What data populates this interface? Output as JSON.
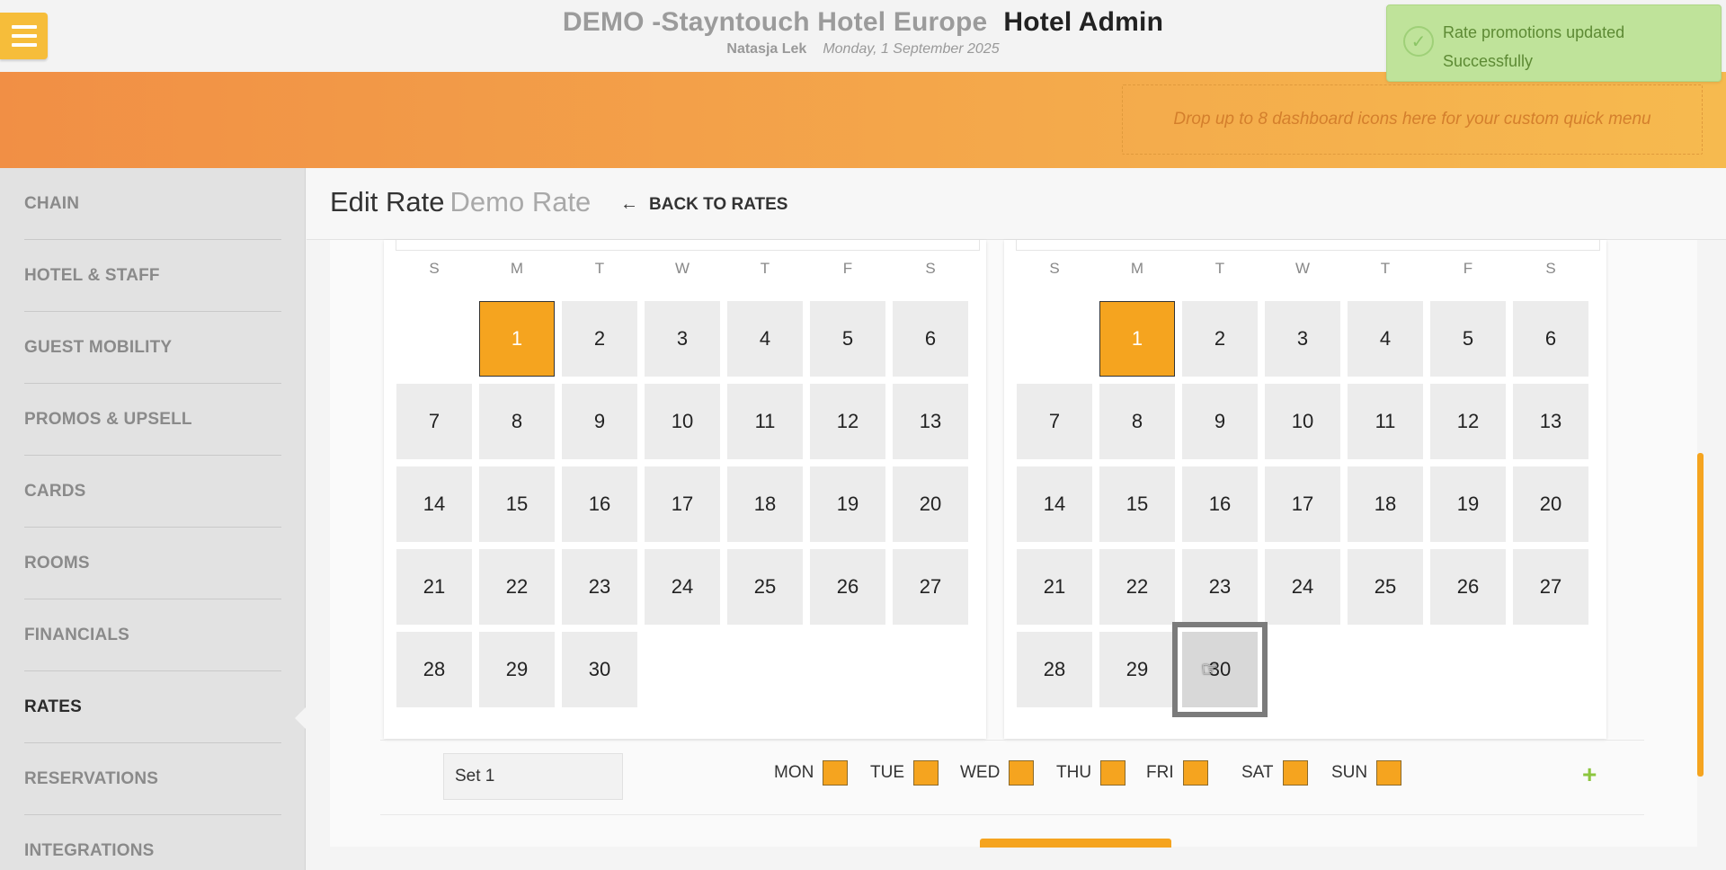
{
  "header": {
    "hotel_name": "DEMO -Stayntouch Hotel Europe",
    "app_name": "Hotel Admin",
    "user_name": "Natasja Lek",
    "date": "Monday, 1 September 2025"
  },
  "toast": {
    "line1": "Rate promotions updated",
    "line2": "Successfully",
    "icon": "check-circle-icon"
  },
  "quickmenu": {
    "placeholder": "Drop up to 8 dashboard icons here for your custom quick menu"
  },
  "sidebar": {
    "items": [
      {
        "label": "CHAIN"
      },
      {
        "label": "HOTEL & STAFF"
      },
      {
        "label": "GUEST MOBILITY"
      },
      {
        "label": "PROMOS & UPSELL"
      },
      {
        "label": "CARDS"
      },
      {
        "label": "ROOMS"
      },
      {
        "label": "FINANCIALS"
      },
      {
        "label": "RATES",
        "active": true
      },
      {
        "label": "RESERVATIONS"
      },
      {
        "label": "INTEGRATIONS"
      }
    ]
  },
  "page": {
    "title": "Edit Rate",
    "rate_name": "Demo Rate",
    "back_label": "BACK TO RATES"
  },
  "calendars": [
    {
      "weekdays": [
        "S",
        "M",
        "T",
        "W",
        "T",
        "F",
        "S"
      ],
      "start_offset": 1,
      "days": [
        "1",
        "2",
        "3",
        "4",
        "5",
        "6",
        "7",
        "8",
        "9",
        "10",
        "11",
        "12",
        "13",
        "14",
        "15",
        "16",
        "17",
        "18",
        "19",
        "20",
        "21",
        "22",
        "23",
        "24",
        "25",
        "26",
        "27",
        "28",
        "29",
        "30"
      ],
      "selected": [
        "1"
      ],
      "hover": []
    },
    {
      "weekdays": [
        "S",
        "M",
        "T",
        "W",
        "T",
        "F",
        "S"
      ],
      "start_offset": 1,
      "days": [
        "1",
        "2",
        "3",
        "4",
        "5",
        "6",
        "7",
        "8",
        "9",
        "10",
        "11",
        "12",
        "13",
        "14",
        "15",
        "16",
        "17",
        "18",
        "19",
        "20",
        "21",
        "22",
        "23",
        "24",
        "25",
        "26",
        "27",
        "28",
        "29",
        "30"
      ],
      "selected": [
        "1"
      ],
      "hover": [
        "30"
      ]
    }
  ],
  "set": {
    "name_value": "Set 1",
    "days": [
      "MON",
      "TUE",
      "WED",
      "THU",
      "FRI",
      "SAT",
      "SUN"
    ],
    "add_label": "+"
  },
  "colors": {
    "accent": "#f5a41f",
    "success": "#bfe39a",
    "add": "#8cc63f"
  }
}
